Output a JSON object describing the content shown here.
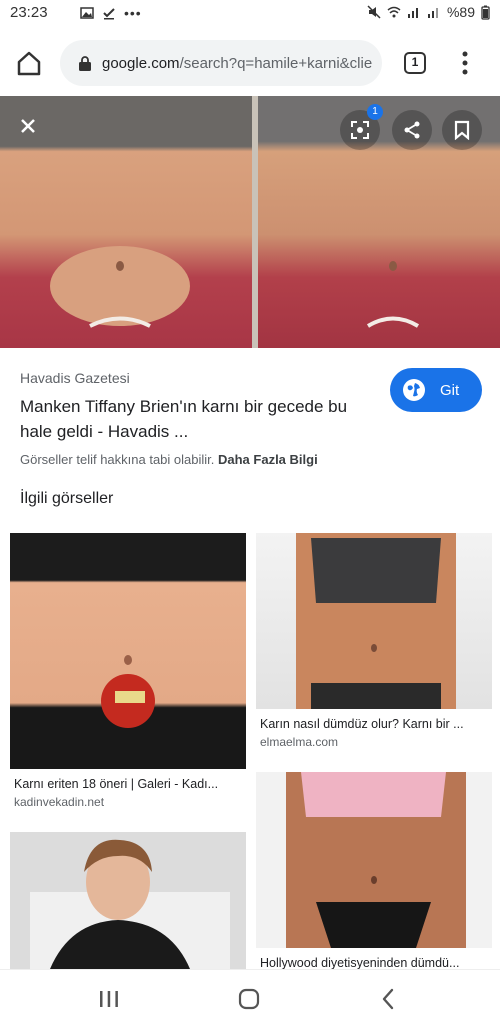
{
  "status": {
    "time": "23:23",
    "battery": "%89"
  },
  "browser": {
    "url_host": "google.com",
    "url_rest": "/search?q=hamile+karni&clie",
    "tab_count": "1"
  },
  "viewer": {
    "lens_badge": "1",
    "source": "Havadis Gazetesi",
    "title": "Manken Tiffany Brien'ın karnı bir gecede bu hale geldi - Havadis ...",
    "visit_label": "Git",
    "copyright_text": "Görseller telif hakkına tabi olabilir.",
    "more_info": "Daha Fazla Bilgi"
  },
  "related": {
    "heading": "İlgili görseller",
    "items": [
      {
        "caption": "Karnı eriten 18 öneri | Galeri - Kadı...",
        "site": "kadinvekadin.net"
      },
      {
        "caption": "Karın nasıl dümdüz olur? Karnı bir ...",
        "site": "elmaelma.com"
      },
      {
        "caption": "",
        "site": ""
      },
      {
        "caption": "Hollywood diyetisyeninden dümdü...",
        "site": ""
      }
    ]
  },
  "icons": [
    "home-icon",
    "lock-icon",
    "tabs-icon",
    "more-vert-icon",
    "close-icon",
    "lens-icon",
    "share-icon",
    "bookmark-icon",
    "globe-icon",
    "recents-icon",
    "home-nav-icon",
    "back-icon"
  ],
  "colors": {
    "accent": "#1a73e8",
    "omnibox": "#f1f3f4"
  }
}
